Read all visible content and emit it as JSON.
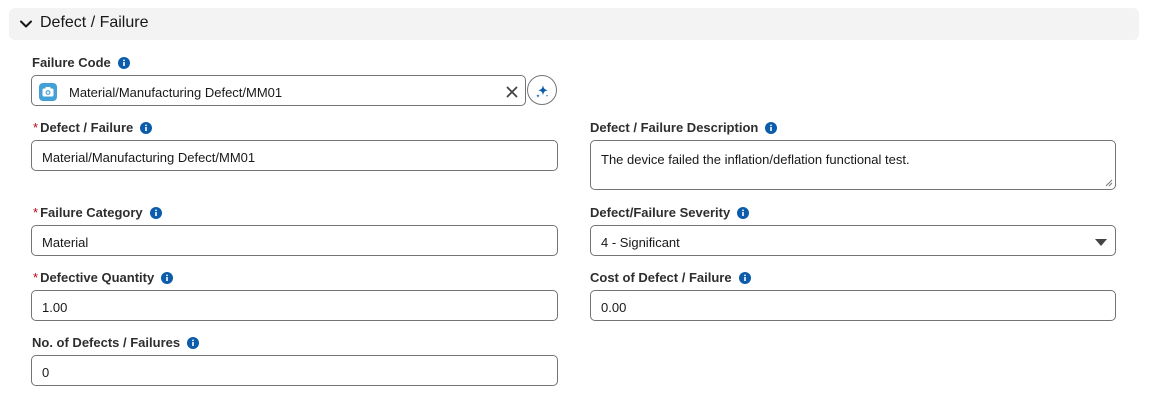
{
  "section": {
    "title": "Defect / Failure"
  },
  "failure_code": {
    "label": "Failure Code",
    "value": "Material/Manufacturing Defect/MM01"
  },
  "defect_failure": {
    "required_mark": "*",
    "label": "Defect / Failure",
    "value": "Material/Manufacturing Defect/MM01"
  },
  "description": {
    "label": "Defect / Failure Description",
    "value": "The device failed the inflation/deflation functional test."
  },
  "failure_category": {
    "required_mark": "*",
    "label": "Failure Category",
    "value": "Material"
  },
  "severity": {
    "label": "Defect/Failure Severity",
    "value": "4 - Significant"
  },
  "defective_quantity": {
    "required_mark": "*",
    "label": "Defective Quantity",
    "value": "1.00"
  },
  "cost": {
    "label": "Cost of Defect / Failure",
    "value": "0.00"
  },
  "num_defects": {
    "label": "No. of Defects / Failures",
    "value": "0"
  },
  "colors": {
    "info_icon": "#0b5cab",
    "required": "#ba0517",
    "border": "#747474",
    "header_bg": "#f3f3f3"
  },
  "icons": [
    "chevron-down-icon",
    "info-icon",
    "camera-icon",
    "close-icon",
    "sparkle-icon",
    "caret-down-icon"
  ]
}
